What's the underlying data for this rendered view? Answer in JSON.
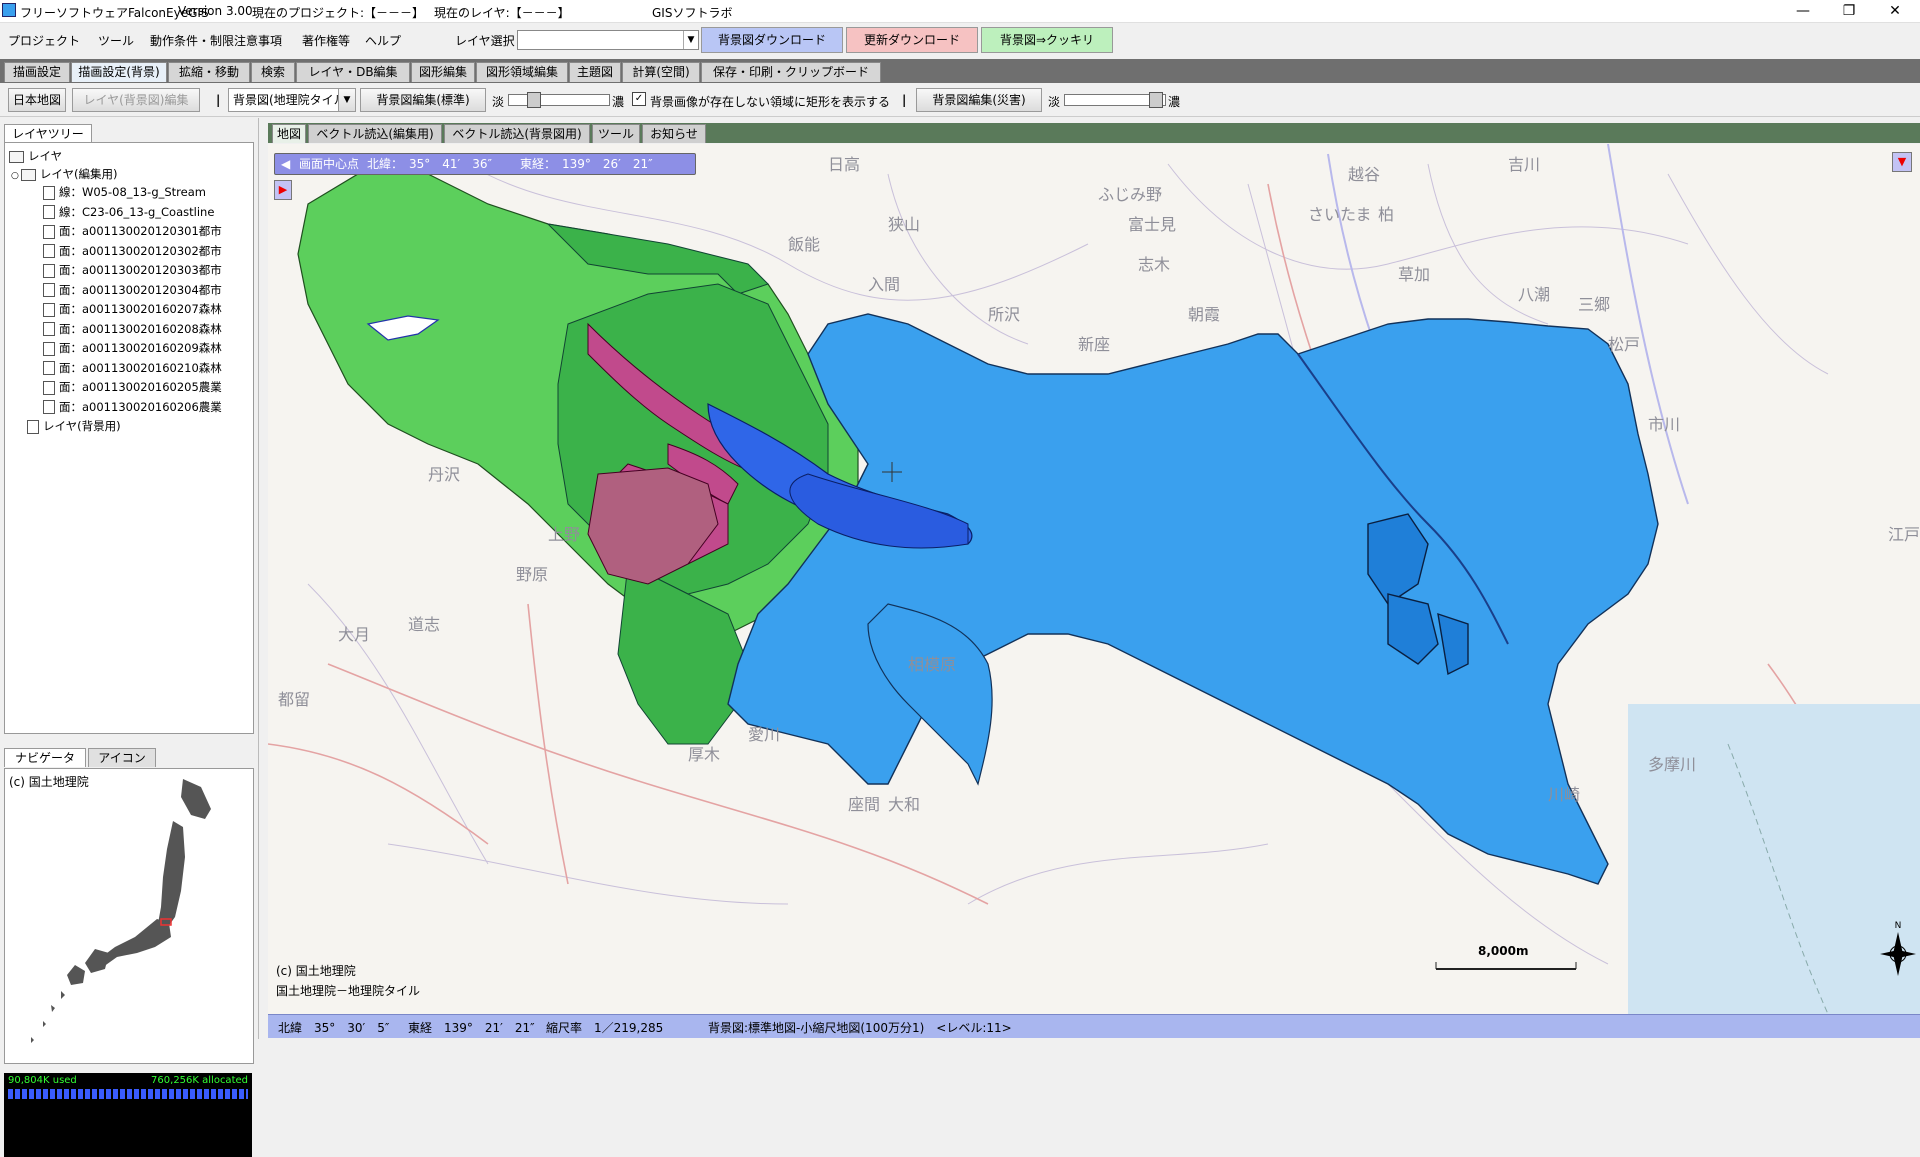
{
  "titlebar": {
    "app": "フリーソフトウェアFalconEyeGIS",
    "version": "Version 3.00",
    "project": "現在のプロジェクト:【－－－】",
    "layer": "現在のレイヤ:【－－－】",
    "lab": "GISソフトラボ"
  },
  "menu": {
    "items": [
      "プロジェクト",
      "ツール",
      "動作条件・制限注意事項",
      "著作権等",
      "ヘルプ"
    ],
    "layer_select_label": "レイヤ選択",
    "btn_bg_download": "背景図ダウンロード",
    "btn_update_download": "更新ダウンロード",
    "btn_bg_sharp": "背景図⇒クッキリ"
  },
  "tabs": [
    "描画設定",
    "描画設定(背景)",
    "拡縮・移動",
    "検索",
    "レイヤ・DB編集",
    "図形編集",
    "図形領域編集",
    "主題図",
    "計算(空間)",
    "保存・印刷・クリップボード"
  ],
  "toolbar": {
    "japan_map": "日本地図",
    "layer_bg_edit": "レイヤ(背景図)編集",
    "bg_select": "背景図(地理院タイル)",
    "bg_edit_std": "背景図編集(標準)",
    "light": "淡",
    "dark": "濃",
    "checkbox_label": "背景画像が存在しない領域に矩形を表示する",
    "bg_edit_disaster": "背景図編集(災害)",
    "slider1_level": 0.2,
    "slider2_level": 0.95
  },
  "leftpanel": {
    "tree_tab": "レイヤツリー",
    "root": "レイヤ",
    "edit_group": "レイヤ(編集用)",
    "layers": [
      "線：W05-08_13-g_Stream",
      "線：C23-06_13-g_Coastline",
      "面：a001130020120301都市",
      "面：a001130020120302都市",
      "面：a001130020120303都市",
      "面：a001130020120304都市",
      "面：a001130020160207森林",
      "面：a001130020160208森林",
      "面：a001130020160209森林",
      "面：a001130020160210森林",
      "面：a001130020160205農業",
      "面：a001130020160206農業"
    ],
    "bg_group": "レイヤ(背景用)",
    "nav_tab": "ナビゲータ",
    "icon_tab": "アイコン",
    "nav_credit": "(c) 国土地理院",
    "mem_used": "90,804K used",
    "mem_alloc": "760,256K allocated"
  },
  "maptabs": [
    "地図",
    "ベクトル読込(編集用)",
    "ベクトル読込(背景図用)",
    "ツール",
    "お知らせ"
  ],
  "map": {
    "center_label": "画面中心点",
    "center_lat": "北緯：　35°　41′　36″",
    "center_lon": "東経：　139°　26′　21″",
    "credit1": "(c) 国土地理院",
    "credit2": "国土地理院－地理院タイル",
    "scale_label": "8,000m",
    "places": [
      "日高",
      "吉川",
      "越谷",
      "狭山",
      "飯能",
      "ふじみ野",
      "富士見",
      "さいたま",
      "入間",
      "志木",
      "草加",
      "八潮",
      "三郷",
      "所沢",
      "朝霞",
      "松戸",
      "新座",
      "市川",
      "江戸川",
      "野原",
      "上野",
      "大月",
      "相模原",
      "愛川",
      "厚木",
      "大和",
      "座間",
      "都留",
      "道志",
      "川崎",
      "多摩川",
      "丹沢",
      "柏"
    ]
  },
  "statusbar": {
    "lat": "北緯　35°　30′　5″",
    "lon": "東経　139°　21′　21″",
    "scale": "縮尺率　1／219,285",
    "bg": "背景図:標準地図-小縮尺地図(100万分1)　<レベル:11>"
  },
  "colors": {
    "menu_btn_blue": "#b9c6f5",
    "menu_btn_red": "#f6c2c2",
    "menu_btn_green": "#bdf0bd",
    "forest": "#5ccf5c",
    "forest_dark": "#3bb24a",
    "urban": "#3aa0ee",
    "agri": "#c14a8c",
    "water": "#2f66e8"
  }
}
